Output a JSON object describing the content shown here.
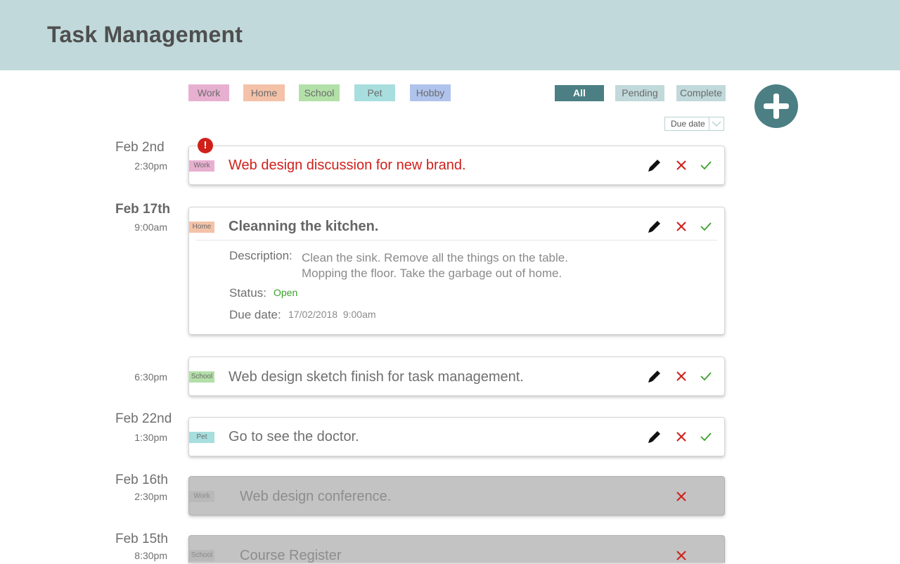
{
  "app": {
    "title": "Task Management"
  },
  "categories": [
    {
      "label": "Work",
      "color": "#e8b0d0"
    },
    {
      "label": "Home",
      "color": "#f4c2a8"
    },
    {
      "label": "School",
      "color": "#b3e0a8"
    },
    {
      "label": "Pet",
      "color": "#a8dede"
    },
    {
      "label": "Hobby",
      "color": "#afc3ec"
    }
  ],
  "filters": {
    "all": "All",
    "pending": "Pending",
    "complete": "Complete",
    "active": "All"
  },
  "sort": {
    "label": "Due date"
  },
  "icons": {
    "add": "plus-icon",
    "edit": "pencil-icon",
    "delete": "close-icon",
    "complete": "check-icon",
    "alert": "exclamation-icon"
  },
  "colors": {
    "accent": "#4b7f83",
    "header": "#c1d9da",
    "overdue": "#d0201a",
    "done_check": "#3aa02a"
  },
  "tasks": [
    {
      "date": "Feb 2nd",
      "time": "2:30pm",
      "tag": "Work",
      "title": "Web design discussion for new brand.",
      "state": "overdue"
    },
    {
      "date": "Feb 17th",
      "time": "9:00am",
      "tag": "Home",
      "title": "Cleanning the kitchen.",
      "state": "expanded",
      "description_label": "Description:",
      "description_line1": "Clean the sink. Remove all the things on the table.",
      "description_line2": "Mopping the floor. Take the garbage out of home.",
      "status_label": "Status:",
      "status_value": "Open",
      "due_label": "Due date:",
      "due_value": "17/02/2018  9:00am"
    },
    {
      "time": "6:30pm",
      "tag": "School",
      "title": "Web design sketch finish for task management.",
      "state": "pending"
    },
    {
      "date": "Feb 22nd",
      "time": "1:30pm",
      "tag": "Pet",
      "title": "Go to see the doctor.",
      "state": "pending"
    },
    {
      "date": "Feb 16th",
      "time": "2:30pm",
      "tag": "Work",
      "title": "Web design conference.",
      "state": "complete"
    },
    {
      "date": "Feb 15th",
      "time": "8:30pm",
      "tag": "School",
      "title": "Course Register",
      "state": "complete"
    }
  ]
}
